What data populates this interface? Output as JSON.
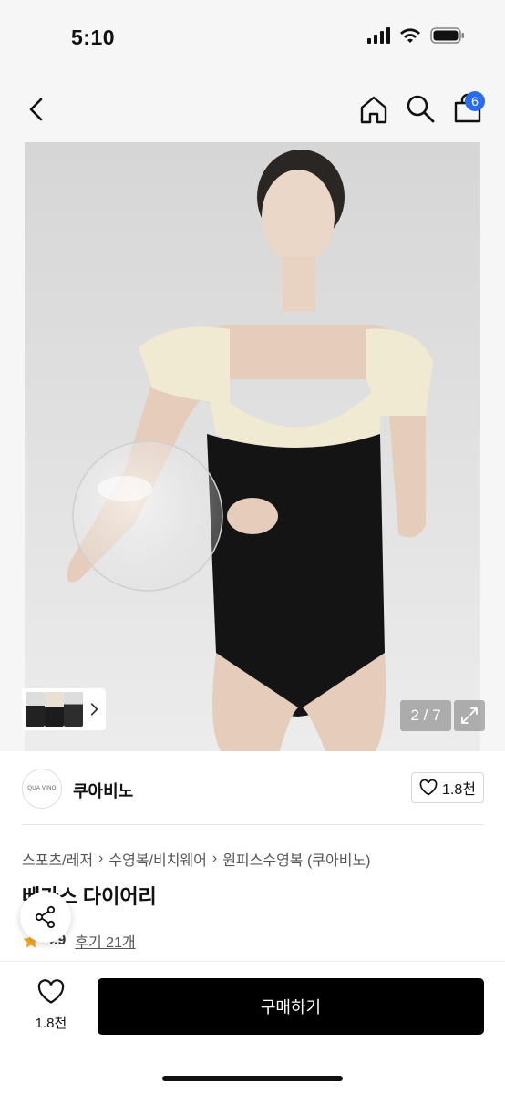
{
  "status": {
    "time": "5:10"
  },
  "nav": {
    "cart_count": "6"
  },
  "gallery": {
    "counter": "2 / 7"
  },
  "brand": {
    "logo_text": "QUA VINO",
    "name": "쿠아비노",
    "like_count": "1.8천"
  },
  "breadcrumb": [
    "스포츠/레저",
    "수영복/비치웨어",
    "원피스수영복 (쿠아비노)"
  ],
  "product": {
    "title": "베가스 다이어리",
    "rating": "4.9",
    "reviews": "후기 21개"
  },
  "bottom": {
    "wish_count": "1.8천",
    "buy_label": "구매하기"
  },
  "icons": [
    "back-icon",
    "home-icon",
    "search-icon",
    "cart-icon",
    "chevron-right-icon",
    "expand-icon",
    "heart-icon",
    "star-icon",
    "share-icon"
  ],
  "colors": {
    "accent_badge": "#2a6cf0",
    "star": "#f5a623",
    "buy_button": "#000000"
  }
}
